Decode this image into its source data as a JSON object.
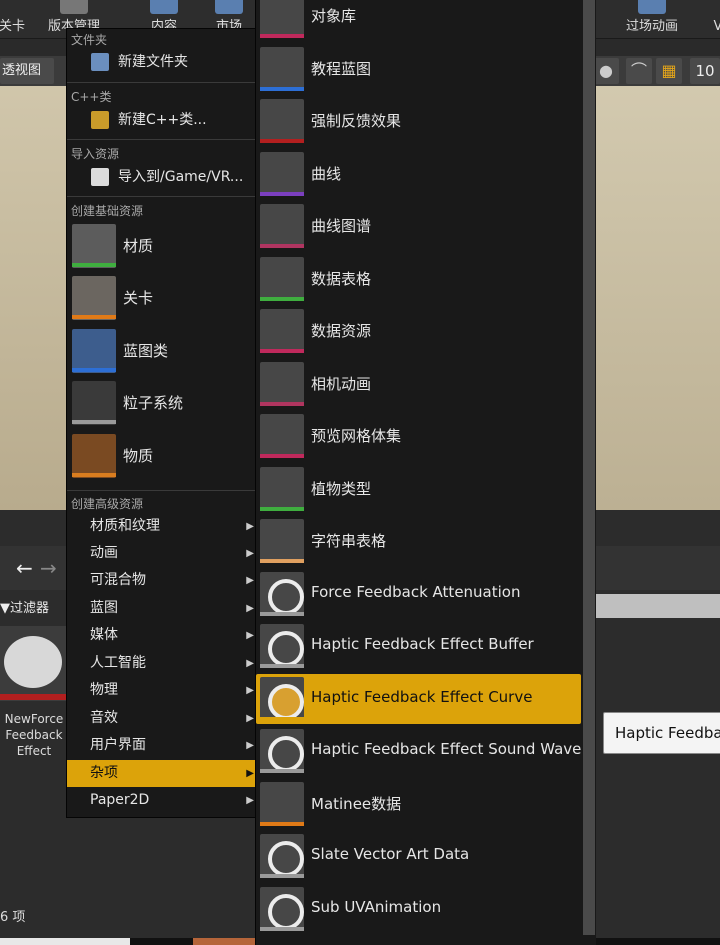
{
  "toolbar": {
    "items": [
      "关卡",
      "版本管理",
      "内容",
      "市场",
      "过场动画",
      "V"
    ]
  },
  "viewport": {
    "perspective_label": "透视图",
    "grid_value": "10"
  },
  "content_browser": {
    "filter_label": "过滤器",
    "asset_name": "NewForceFeedbackEffect",
    "asset_name_lines": [
      "NewForce",
      "Feedback",
      "Effect"
    ],
    "item_count": "6 项",
    "rename_value": "Haptic Feedback"
  },
  "context_menu": {
    "sections": {
      "folder": "文件夹",
      "cpp": "C++类",
      "import": "导入资源",
      "basic": "创建基础资源",
      "advanced": "创建高级资源"
    },
    "new_folder": "新建文件夹",
    "new_cpp_class": "新建C++类...",
    "import_to": "导入到/Game/VR...",
    "basic_assets": [
      {
        "label": "材质",
        "icon": "material-icon",
        "color": "#3fae3f"
      },
      {
        "label": "关卡",
        "icon": "level-icon",
        "color": "#e07a17"
      },
      {
        "label": "蓝图类",
        "icon": "blueprint-icon",
        "color": "#2d6fd6"
      },
      {
        "label": "粒子系统",
        "icon": "particle-icon",
        "color": "#9a9a9a"
      },
      {
        "label": "物质",
        "icon": "substance-icon",
        "color": "#d97d1f"
      }
    ],
    "submenus": [
      "材质和纹理",
      "动画",
      "可混合物",
      "蓝图",
      "媒体",
      "人工智能",
      "物理",
      "音效",
      "用户界面",
      "杂项",
      "Paper2D"
    ],
    "active_submenu": "杂项"
  },
  "misc_menu": {
    "items": [
      {
        "label": "对象库",
        "icon": "object-library-icon",
        "color": "#c0295c"
      },
      {
        "label": "教程蓝图",
        "icon": "tutorial-blueprint-icon",
        "color": "#2d6fd6"
      },
      {
        "label": "强制反馈效果",
        "icon": "force-feedback-icon",
        "color": "#b31f1f"
      },
      {
        "label": "曲线",
        "icon": "curve-icon",
        "color": "#7b3fbf"
      },
      {
        "label": "曲线图谱",
        "icon": "curve-atlas-icon",
        "color": "#b03561"
      },
      {
        "label": "数据表格",
        "icon": "data-table-icon",
        "color": "#3fae3f"
      },
      {
        "label": "数据资源",
        "icon": "data-asset-icon",
        "color": "#c0295c"
      },
      {
        "label": "相机动画",
        "icon": "camera-anim-icon",
        "color": "#b0355f"
      },
      {
        "label": "预览网格体集",
        "icon": "preview-mesh-icon",
        "color": "#c0295c"
      },
      {
        "label": "植物类型",
        "icon": "foliage-type-icon",
        "color": "#3fae3f"
      },
      {
        "label": "字符串表格",
        "icon": "string-table-icon",
        "color": "#e0a060"
      },
      {
        "label": "Force Feedback Attenuation",
        "icon": "ring-icon",
        "color": "#9a9a9a"
      },
      {
        "label": "Haptic Feedback Effect Buffer",
        "icon": "ring-icon",
        "color": "#9a9a9a"
      },
      {
        "label": "Haptic Feedback Effect Curve",
        "icon": "ring-icon",
        "color": "#dca30a"
      },
      {
        "label": "Haptic Feedback Effect Sound Wave",
        "icon": "ring-icon",
        "color": "#9a9a9a"
      },
      {
        "label": "Matinee数据",
        "icon": "matinee-icon",
        "color": "#e07a17"
      },
      {
        "label": "Slate Vector Art Data",
        "icon": "ring-icon",
        "color": "#9a9a9a"
      },
      {
        "label": "Sub UVAnimation",
        "icon": "ring-icon",
        "color": "#9a9a9a"
      }
    ],
    "highlighted": "Haptic Feedback Effect Curve"
  }
}
